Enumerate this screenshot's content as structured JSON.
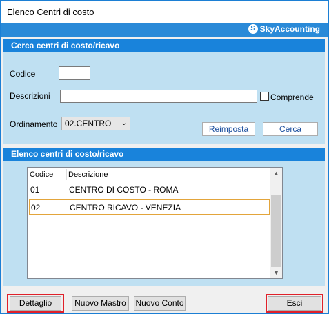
{
  "window": {
    "title": "Elenco Centri di costo"
  },
  "brand": {
    "name": "SkyAccounting"
  },
  "search_panel": {
    "header": "Cerca centri di costo/ricavo",
    "codice_label": "Codice",
    "codice_value": "",
    "descrizioni_label": "Descrizioni",
    "descrizioni_value": "",
    "comprende_label": "Comprende",
    "comprende_checked": false,
    "ordinamento_label": "Ordinamento",
    "ordinamento_value": "02.CENTRO",
    "reimposta_label": "Reimposta",
    "cerca_label": "Cerca"
  },
  "list_panel": {
    "header": "Elenco centri di costo/ricavo",
    "columns": [
      "Codice",
      "Descrizione"
    ],
    "rows": [
      {
        "codice": "01",
        "descrizione": "CENTRO DI COSTO - ROMA"
      },
      {
        "codice": "02",
        "descrizione": "CENTRO RICAVO - VENEZIA"
      }
    ],
    "selected_row": 1
  },
  "footer": {
    "dettaglio_label": "Dettaglio",
    "nuovo_mastro_label": "Nuovo Mastro",
    "nuovo_conto_label": "Nuovo Conto",
    "esci_label": "Esci"
  },
  "colors": {
    "accent": "#1983db",
    "panel_bg": "#bfe0f2",
    "highlight": "#e0212a",
    "selection": "#e3a53b"
  }
}
